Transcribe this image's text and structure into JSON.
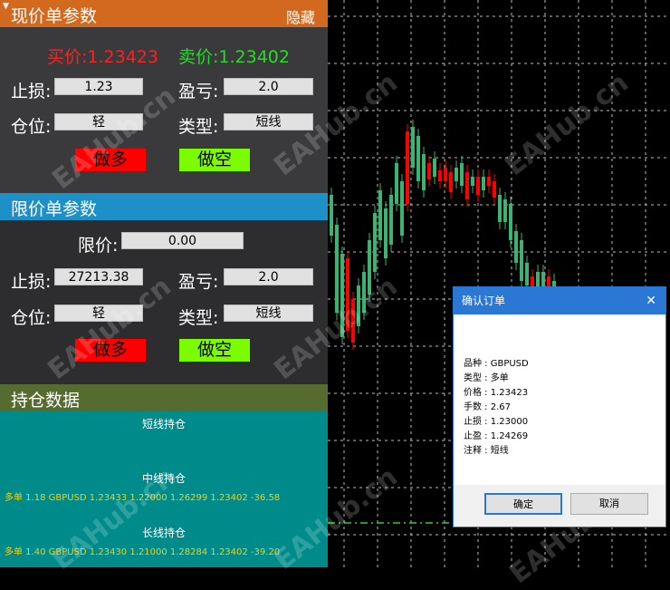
{
  "market": {
    "title": "现价单参数",
    "hide_label": "隐藏",
    "buy_price": "买价:1.23423",
    "sell_price": "卖价:1.23402",
    "sl_label": "止损:",
    "sl_value": "1.23",
    "tp_label": "盈亏:",
    "tp_value": "2.0",
    "lot_label": "仓位:",
    "lot_value": "轻",
    "type_label": "类型:",
    "type_value": "短线",
    "long_btn": "做多",
    "short_btn": "做空"
  },
  "limit": {
    "title": "限价单参数",
    "price_label": "限价:",
    "price_value": "0.00",
    "sl_label": "止损:",
    "sl_value": "27213.38",
    "tp_label": "盈亏:",
    "tp_value": "2.0",
    "lot_label": "仓位:",
    "lot_value": "轻",
    "type_label": "类型:",
    "type_value": "短线",
    "long_btn": "做多",
    "short_btn": "做空"
  },
  "positions": {
    "title": "持仓数据",
    "short_title": "短线持仓",
    "mid_title": "中线持仓",
    "mid_line": "多单 1.18  GBPUSD 1.23433 1.22000 1.26299 1.23402 -36.58",
    "long_title": "长线持仓",
    "long_line": "多单 1.40  GBPUSD 1.23430 1.21000 1.28284 1.23402 -39.20"
  },
  "dialog": {
    "title": "确认订单",
    "close": "✕",
    "lines": [
      "品种 :  GBPUSD",
      "类型 :  多单",
      "价格 :  1.23423",
      "手数 :  2.67",
      "止损 :  1.23000",
      "止盈 :  1.24269",
      "注释 :  短线"
    ],
    "ok": "确定",
    "cancel": "取消"
  },
  "watermark": "EAHub.cn",
  "colors": {
    "market_header": "#d2691e",
    "limit_header": "#1e90c8",
    "positions_header": "#556b2f",
    "positions_bg": "#008b8b",
    "bull": "#3cb371",
    "bear": "#ff0000"
  }
}
